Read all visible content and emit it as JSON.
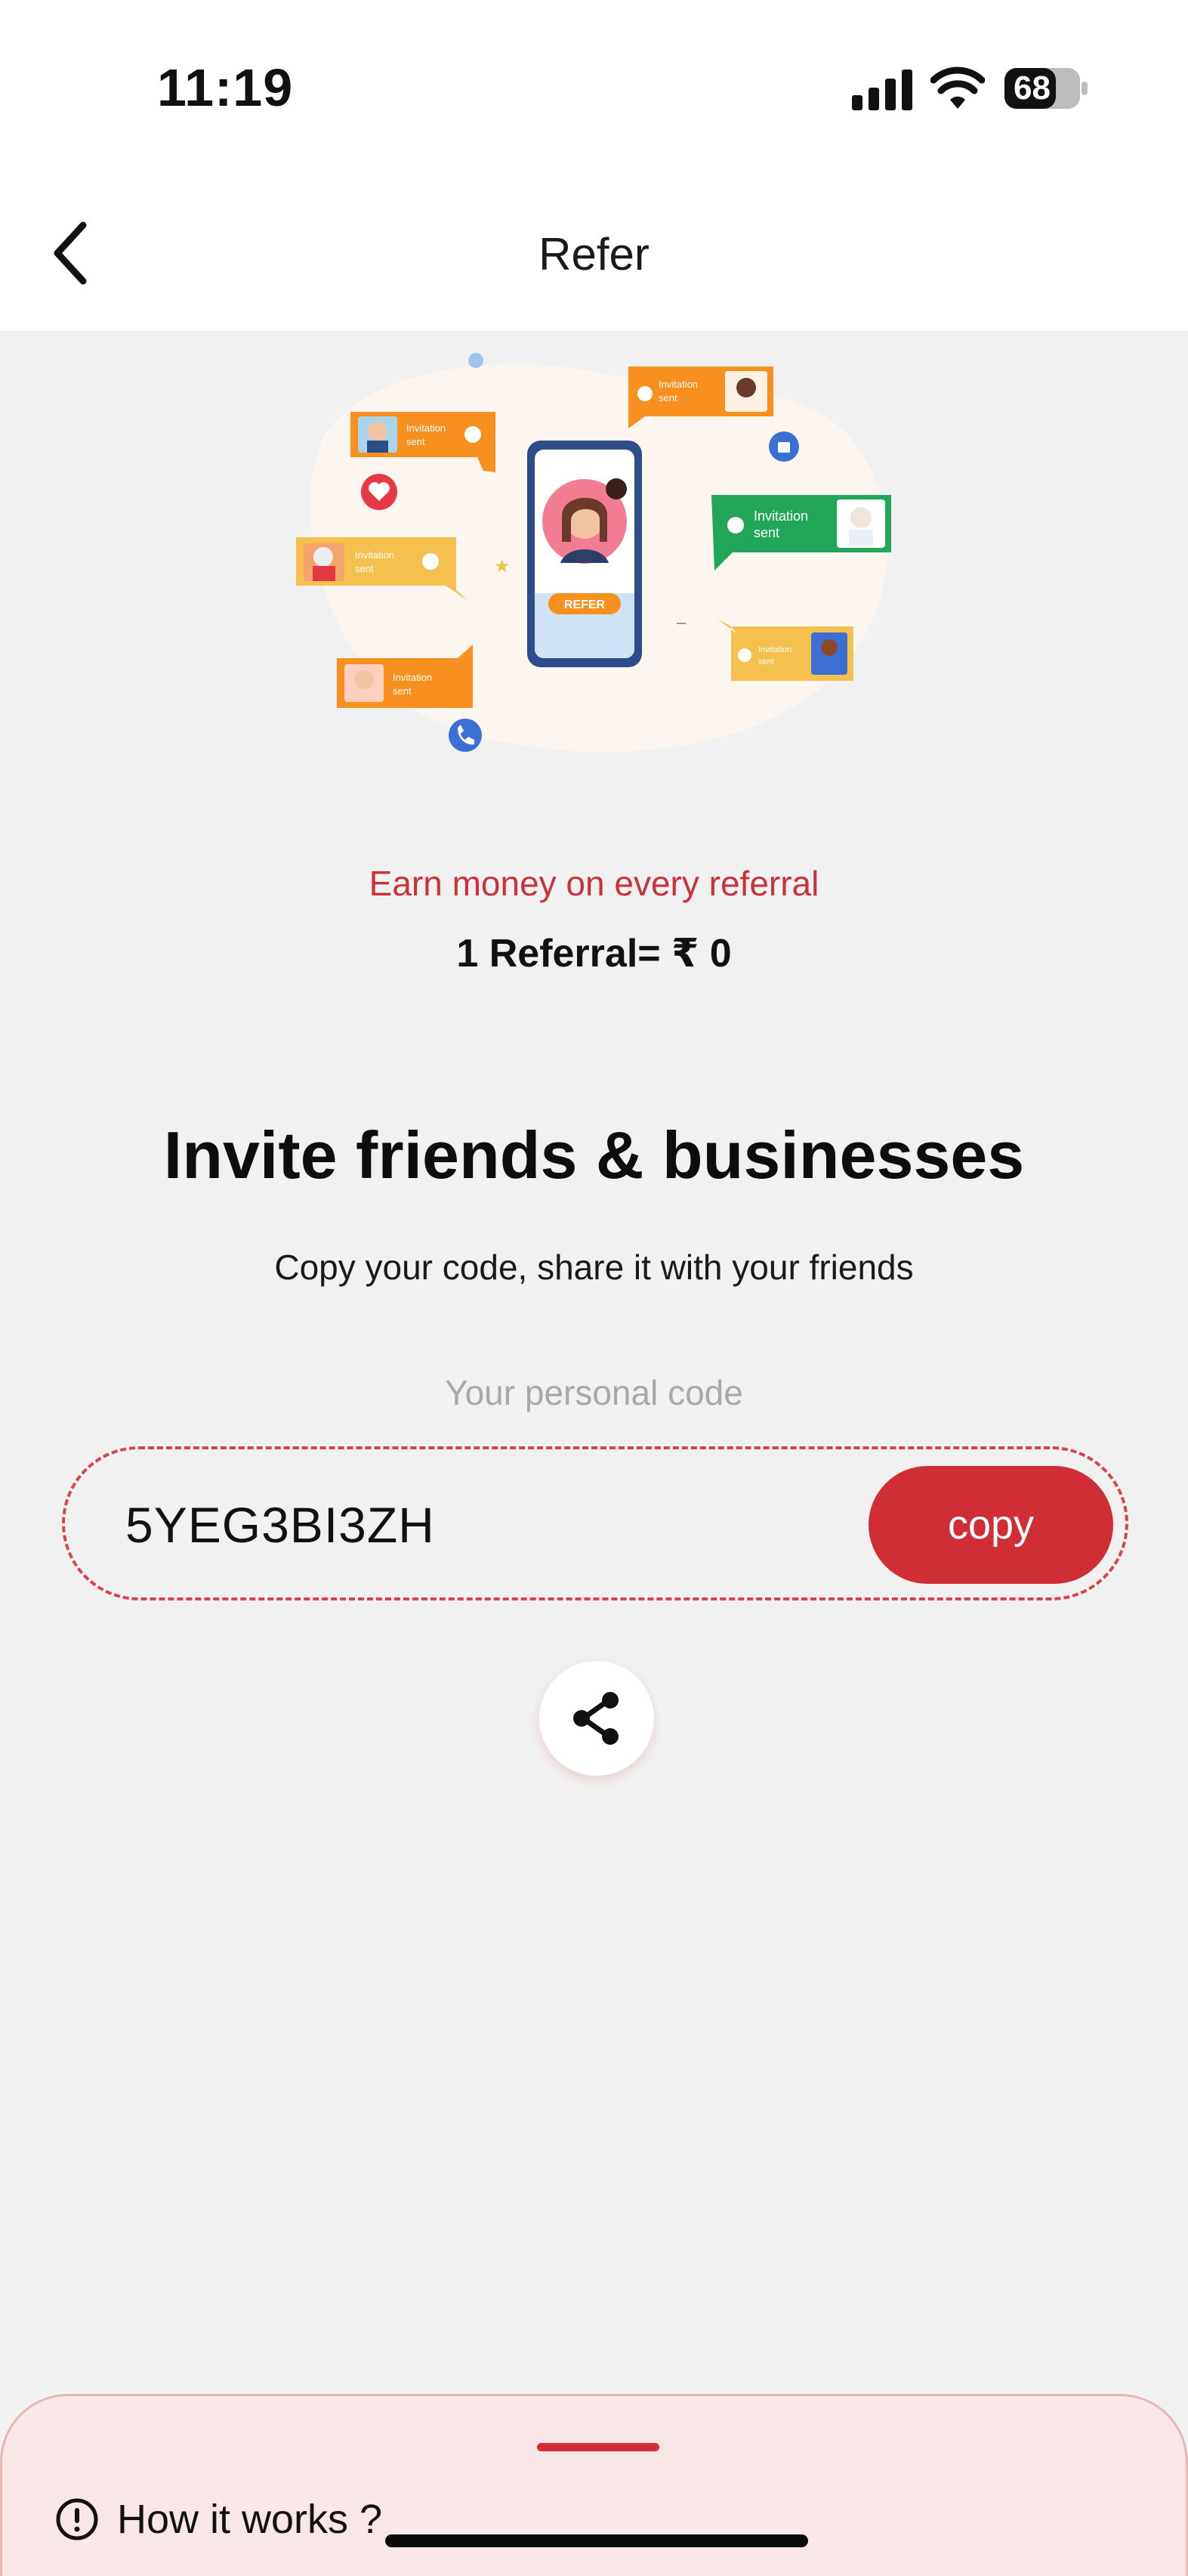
{
  "status_bar": {
    "time": "11:19",
    "battery": "68",
    "icons": [
      "signal-icon",
      "wifi-icon",
      "battery-icon"
    ]
  },
  "nav": {
    "title": "Refer",
    "back_icon": "chevron-left-icon"
  },
  "illustration": {
    "phone_button": "REFER",
    "bubble_text_1": "Invitation",
    "bubble_text_2": "sent"
  },
  "referral": {
    "earn_text": "Earn money on every referral",
    "rate_text": "1 Referral= ₹ 0"
  },
  "invite": {
    "title": "Invite friends & businesses",
    "subtitle": "Copy your code, share it with your friends"
  },
  "code": {
    "label": "Your personal code",
    "value": "5YEG3BI3ZH",
    "copy_label": "copy"
  },
  "share": {
    "icon": "share-icon"
  },
  "bottom_sheet": {
    "how_label": "How it works ?",
    "icon": "info-icon"
  },
  "colors": {
    "accent": "#cf2e35",
    "earn_text": "#c8323a",
    "background": "#f2f1f1",
    "sheet_bg": "#f8e7e6",
    "bubble_orange": "#f7901e",
    "bubble_green": "#22a65a",
    "bubble_yellow": "#f6c04e"
  }
}
